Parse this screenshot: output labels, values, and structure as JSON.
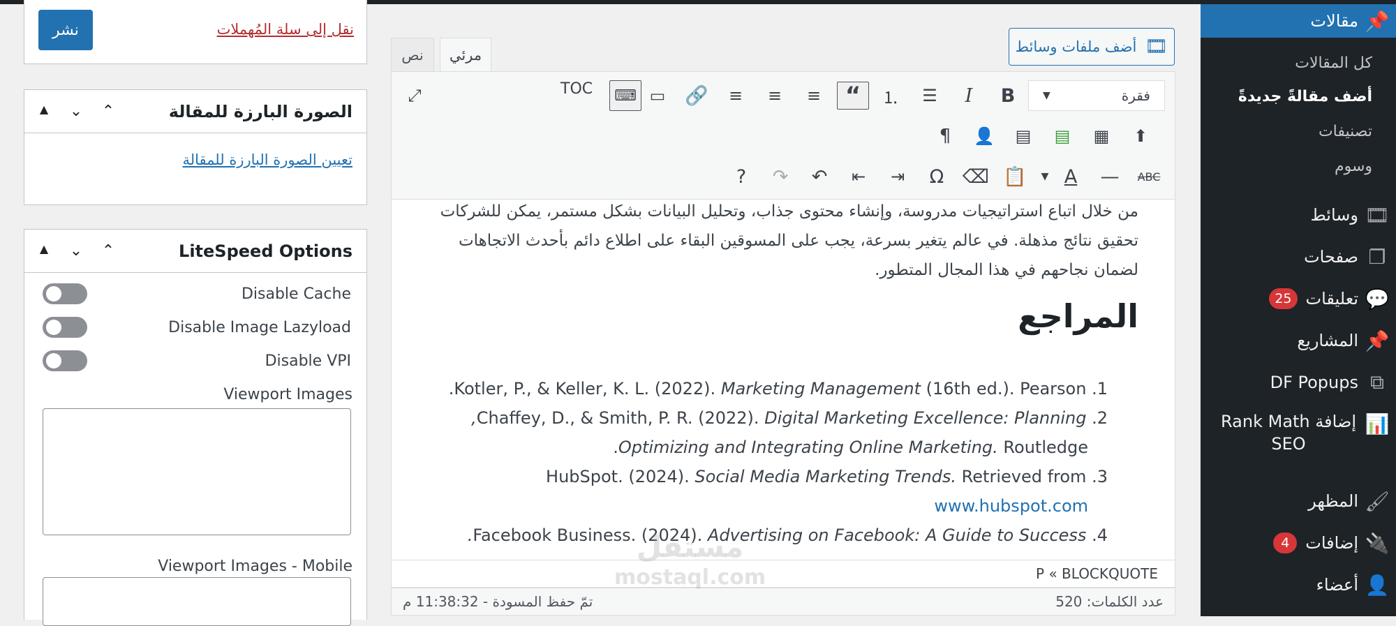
{
  "menu": {
    "posts": "مقالات",
    "all_posts": "كل المقالات",
    "add_new": "أضف مقالةً جديدةً",
    "categories": "تصنيفات",
    "tags": "وسوم",
    "media": "وسائط",
    "pages": "صفحات",
    "comments": "تعليقات",
    "comments_count": "25",
    "projects": "المشاريع",
    "df_popups": "DF Popups",
    "rank_math": "إضافة Rank Math SEO",
    "appearance": "المظهر",
    "plugins": "إضافات",
    "plugins_count": "4",
    "users": "أعضاء"
  },
  "editor": {
    "add_media": "أضف ملفات وسائط",
    "tab_visual": "مرئي",
    "tab_text": "نص",
    "format": "فقرة",
    "toc": "TOC",
    "paragraph_lines": [
      "من خلال اتباع استراتيجيات مدروسة، وإنشاء محتوى جذاب، وتحليل البيانات بشكل مستمر، يمكن للشركات",
      "تحقيق نتائج مذهلة. في عالم يتغير بسرعة، يجب على المسوقين البقاء على اطلاع دائم بأحدث الاتجاهات",
      "لضمان نجاحهم في هذا المجال المتطور."
    ],
    "heading": "المراجع",
    "refs": [
      {
        "num": "1.",
        "authors": "Kotler, P., & Keller, K. L. (2022).",
        "title": "Marketing Management",
        "rest": "(16th ed.). Pearson."
      },
      {
        "num": "2.",
        "authors": "Chaffey, D., & Smith, P. R. (2022).",
        "title": "Digital Marketing Excellence: Planning,",
        "title2": "Optimizing and Integrating Online Marketing.",
        "rest": "Routledge."
      },
      {
        "num": "3.",
        "authors": "HubSpot. (2024).",
        "title": "Social Media Marketing Trends.",
        "rest": "Retrieved from",
        "link": "www.hubspot.com"
      },
      {
        "num": "4.",
        "authors": "Facebook Business. (2024).",
        "title": "Advertising on Facebook: A Guide to Success.",
        "rest": ""
      }
    ],
    "path": "P « BLOCKQUOTE",
    "word_count": "عدد الكلمات: 520",
    "draft_saved": "تمّ حفظ المسودة - 11:38:32 م"
  },
  "publish": {
    "button": "نشر",
    "trash": "نقل إلى سلة المُهملات"
  },
  "featured_image": {
    "title": "الصورة البارزة للمقالة",
    "set_link": "تعيين الصورة البارزة للمقالة"
  },
  "litespeed": {
    "title": "LiteSpeed Options",
    "disable_cache": "Disable Cache",
    "disable_lazyload": "Disable Image Lazyload",
    "disable_vpi": "Disable VPI",
    "viewport_images": "Viewport Images",
    "viewport_images_mobile": "Viewport Images - Mobile"
  },
  "watermark": {
    "line1": "مستقل",
    "line2": "mostaql.com"
  }
}
